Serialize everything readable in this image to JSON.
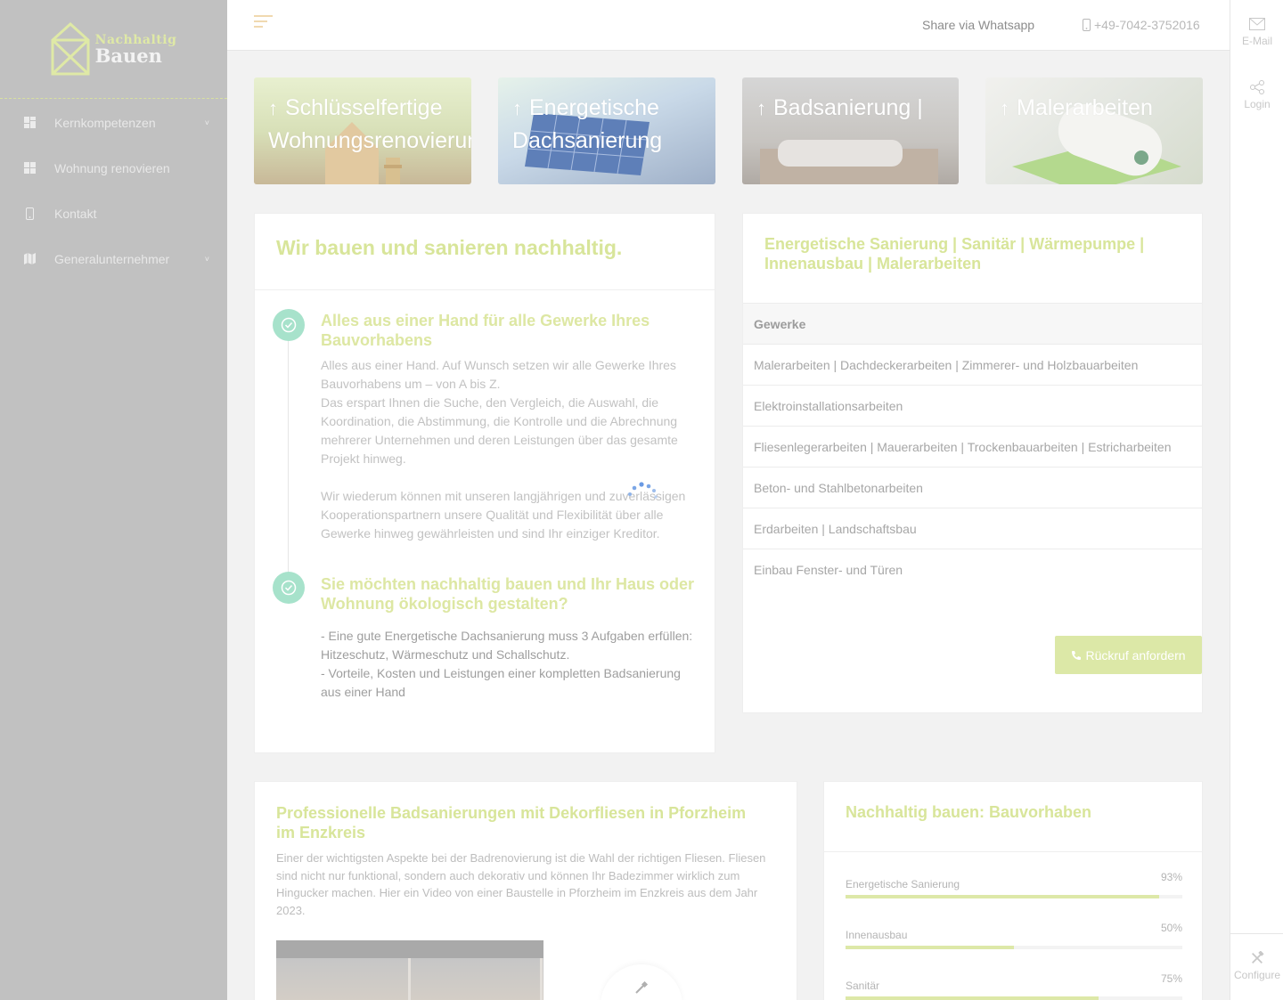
{
  "brand": {
    "line1": "Nachhaltig",
    "line2": "Bauen"
  },
  "sidebar": {
    "items": [
      {
        "label": "Kernkompetenzen",
        "icon": "dashboard-icon",
        "has_submenu": true
      },
      {
        "label": "Wohnung renovieren",
        "icon": "dashboard-icon",
        "has_submenu": false
      },
      {
        "label": "Kontakt",
        "icon": "mobile-icon",
        "has_submenu": false
      },
      {
        "label": "Generalunternehmer",
        "icon": "map-icon",
        "has_submenu": true
      }
    ]
  },
  "topbar": {
    "share_label": "Share via Whatsapp",
    "phone": "+49-7042-3752016"
  },
  "rightbar": {
    "email_label": "E-Mail",
    "login_label": "Login",
    "configure_label": "Configure"
  },
  "tiles": [
    {
      "line1": "Schlüsselfertige",
      "line2": "Wohnungsrenovierung"
    },
    {
      "line1": "Energetische",
      "line2": "Dachsanierung"
    },
    {
      "line1": "Badsanierung |",
      "line2": ""
    },
    {
      "line1": "Malerarbeiten",
      "line2": ""
    }
  ],
  "intro": {
    "title": "Wir bauen und sanieren nachhaltig.",
    "item1_title": "Alles aus einer Hand für alle Gewerke Ihres Bauvorhabens",
    "item1_p1": "Alles aus einer Hand. Auf Wunsch setzen wir alle Gewerke Ihres Bauvorhabens um – von A bis Z.",
    "item1_p2": "Das erspart Ihnen die Suche, den Vergleich, die Auswahl, die Koordination, die Abstimmung, die Kontrolle und die Abrechnung mehrerer Unternehmen und deren Leistungen über das gesamte Projekt hinweg.",
    "item1_p3": "Wir wiederum können mit unseren langjährigen und zuverlässigen Kooperationspartnern unsere Qualität und Flexibilität über alle Gewerke hinweg gewährleisten und sind Ihr einziger Kreditor.",
    "item2_title": "Sie möchten nachhaltig bauen und Ihr Haus oder Wohnung ökologisch gestalten?",
    "item2_p1": "- Eine gute Energetische Dachsanierung muss 3 Aufgaben erfüllen: Hitzeschutz, Wärmeschutz und Schallschutz.",
    "item2_p2": "- Vorteile, Kosten und Leistungen einer kompletten Badsanierung aus einer Hand"
  },
  "services": {
    "title": "Energetische Sanierung | Sanitär | Wärmepumpe | Innenausbau | Malerarbeiten",
    "header": "Gewerke",
    "rows": [
      "Malerarbeiten | Dachdeckerarbeiten | Zimmerer- und Holzbauarbeiten",
      "Elektroinstallationsarbeiten",
      "Fliesenlegerarbeiten | Mauerarbeiten | Trockenbauarbeiten | Estricharbeiten",
      "Beton- und Stahlbetonarbeiten",
      "Erdarbeiten | Landschaftsbau",
      "Einbau Fenster- und Türen"
    ],
    "callback_label": "Rückruf anfordern"
  },
  "bath": {
    "title": "Professionelle Badsanierungen mit Dekorfliesen in Pforzheim im Enzkreis",
    "text": "Einer der wichtigsten Aspekte bei der Badrenovierung ist die Wahl der richtigen Fliesen. Fliesen sind nicht nur funktional, sondern auch dekorativ und können Ihr Badezimmer wirklich zum Hingucker machen. Hier ein Video von einer Baustelle in Pforzheim im Enzkreis aus dem Jahr 2023."
  },
  "projects": {
    "title": "Nachhaltig bauen: Bauvorhaben",
    "items": [
      {
        "label": "Energetische Sanierung",
        "value": "93%",
        "fraction": 0.93
      },
      {
        "label": "Innenausbau",
        "value": "50%",
        "fraction": 0.5
      },
      {
        "label": "Sanitär",
        "value": "75%",
        "fraction": 0.75
      }
    ]
  }
}
